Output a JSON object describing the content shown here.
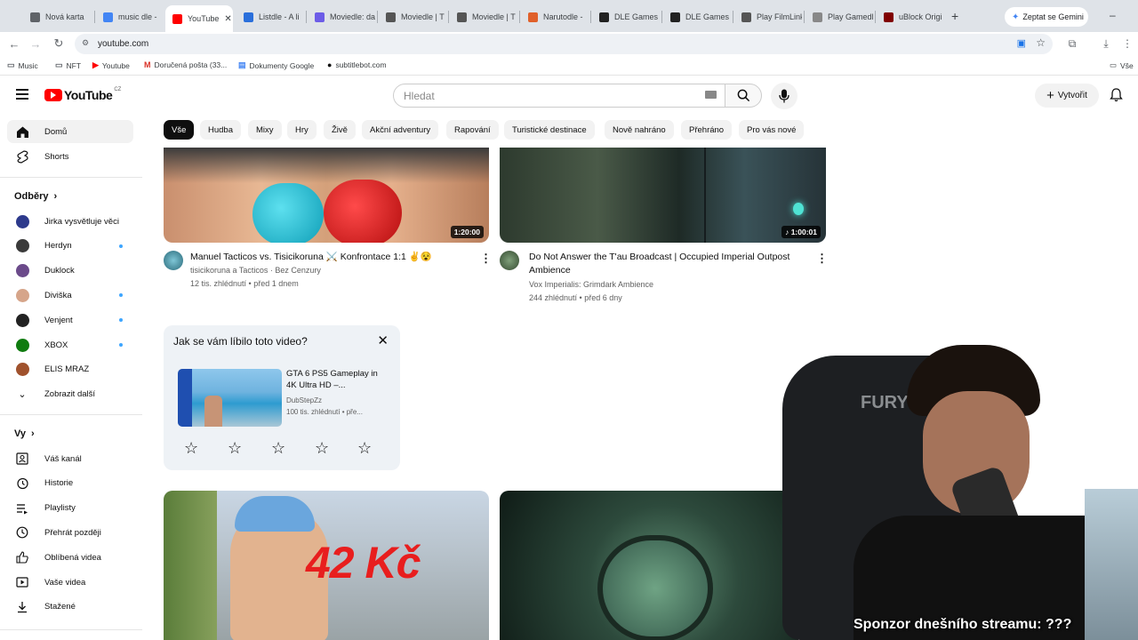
{
  "browser": {
    "tabs": [
      {
        "label": "Nová karta",
        "fav": "#5f6368"
      },
      {
        "label": "music dle - ",
        "fav": "#4285f4"
      },
      {
        "label": "YouTube",
        "fav": "#ff0000"
      },
      {
        "label": "Listdle - A li",
        "fav": "#2a6fdb"
      },
      {
        "label": "Moviedle: da",
        "fav": "#6c5ce7"
      },
      {
        "label": "Moviedle | T",
        "fav": "#555"
      },
      {
        "label": "Moviedle | T",
        "fav": "#555"
      },
      {
        "label": "Narutodle - ",
        "fav": "#e0602a"
      },
      {
        "label": "DLE Games",
        "fav": "#222"
      },
      {
        "label": "DLE Games",
        "fav": "#222"
      },
      {
        "label": "Play FilmLink",
        "fav": "#555"
      },
      {
        "label": "Play Gamedl",
        "fav": "#888"
      },
      {
        "label": "uBlock Origi",
        "fav": "#800000"
      }
    ],
    "new_tab": "+",
    "gemini_label": "Zeptat se Gemini",
    "url": "youtube.com",
    "bookmarks": [
      {
        "label": "Music",
        "icon": "folder-icon"
      },
      {
        "label": "NFT",
        "icon": "folder-icon"
      },
      {
        "label": "Youtube",
        "icon": "youtube-icon"
      },
      {
        "label": "Doručená pošta (33...",
        "icon": "gmail-icon"
      },
      {
        "label": "Dokumenty Google",
        "icon": "docs-icon"
      },
      {
        "label": "subtitlebot.com",
        "icon": "globe-icon"
      }
    ],
    "bookmarks_right": "Vše"
  },
  "yt": {
    "logo_text": "YouTube",
    "region": "CZ",
    "search_placeholder": "Hledat",
    "create_label": "Vytvořit"
  },
  "sidebar": {
    "main": [
      {
        "label": "Domů",
        "icon": "home-icon"
      },
      {
        "label": "Shorts",
        "icon": "shorts-icon"
      }
    ],
    "subs_heading": "Odběry",
    "subs": [
      {
        "label": "Jirka vysvětluje věci",
        "color": "#2d3a8c",
        "dot": false
      },
      {
        "label": "Herdyn",
        "color": "#3a3a3a",
        "dot": true
      },
      {
        "label": "Duklock",
        "color": "#6b4a8a",
        "dot": false
      },
      {
        "label": "Diviška",
        "color": "#d6a58a",
        "dot": true
      },
      {
        "label": "Venjent",
        "color": "#222",
        "dot": true
      },
      {
        "label": "XBOX",
        "color": "#107c10",
        "dot": true
      },
      {
        "label": "ELIS MRAZ",
        "color": "#a0522d",
        "dot": false
      }
    ],
    "show_more": "Zobrazit další",
    "you_heading": "Vy",
    "you": [
      {
        "label": "Váš kanál",
        "icon": "channel-icon"
      },
      {
        "label": "Historie",
        "icon": "history-icon"
      },
      {
        "label": "Playlisty",
        "icon": "playlist-icon"
      },
      {
        "label": "Přehrát později",
        "icon": "clock-icon"
      },
      {
        "label": "Oblíbená videa",
        "icon": "like-icon"
      },
      {
        "label": "Vaše videa",
        "icon": "video-icon"
      },
      {
        "label": "Stažené",
        "icon": "download-icon"
      }
    ]
  },
  "chips": [
    "Vše",
    "Hudba",
    "Mixy",
    "Hry",
    "Živě",
    "Akční adventury",
    "Rapování",
    "Turistické destinace",
    "Nově nahráno",
    "Přehráno",
    "Pro vás nové"
  ],
  "videos": [
    {
      "title": "Manuel Tacticos vs. Tisicikoruna ⚔️ Konfrontace 1:1 ✌️😵",
      "channel": "tisicikoruna a Tacticos · Bez Cenzury",
      "meta": "12 tis. zhlédnutí • před 1 dnem",
      "duration": "1:20:00"
    },
    {
      "title": "Do Not Answer the T'au Broadcast | Occupied Imperial Outpost Ambience",
      "channel": "Vox Imperialis: Grimdark Ambience",
      "meta": "244 zhlédnutí • před 6 dny",
      "duration": "♪ 1:00:01"
    }
  ],
  "survey": {
    "question": "Jak se vám líbilo toto video?",
    "video_title": "GTA 6 PS5 Gameplay in 4K Ultra HD –...",
    "channel": "DubStepZz",
    "meta": "100 tis. zhlédnutí • pře...",
    "rating": 0,
    "max_rating": 5
  },
  "bottom_thumbs": [
    {
      "overlay_text": "42 Kč"
    }
  ],
  "stream_caption": "Sponzor dnešního streamu: ???"
}
